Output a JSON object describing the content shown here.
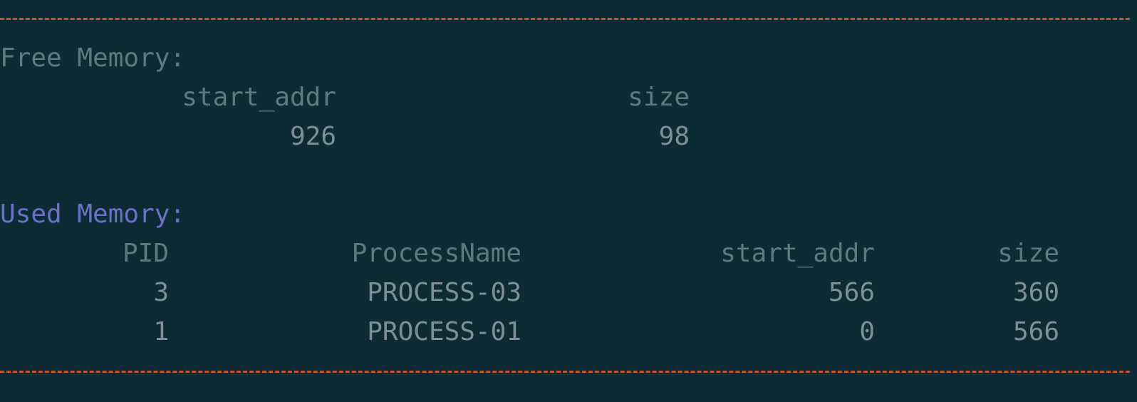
{
  "terminal": {
    "separator_color": "#c5532a",
    "background": "#0d2a35",
    "accent": "#6c71c4"
  },
  "free_memory": {
    "title": "Free Memory:",
    "columns": [
      "start_addr",
      "size"
    ],
    "rows": [
      [
        "926",
        "98"
      ]
    ]
  },
  "used_memory": {
    "title": "Used Memory:",
    "columns": [
      "PID",
      "ProcessName",
      "start_addr",
      "size"
    ],
    "rows": [
      [
        "3",
        "PROCESS-03",
        "566",
        "360"
      ],
      [
        "1",
        "PROCESS-01",
        "0",
        "566"
      ]
    ]
  }
}
